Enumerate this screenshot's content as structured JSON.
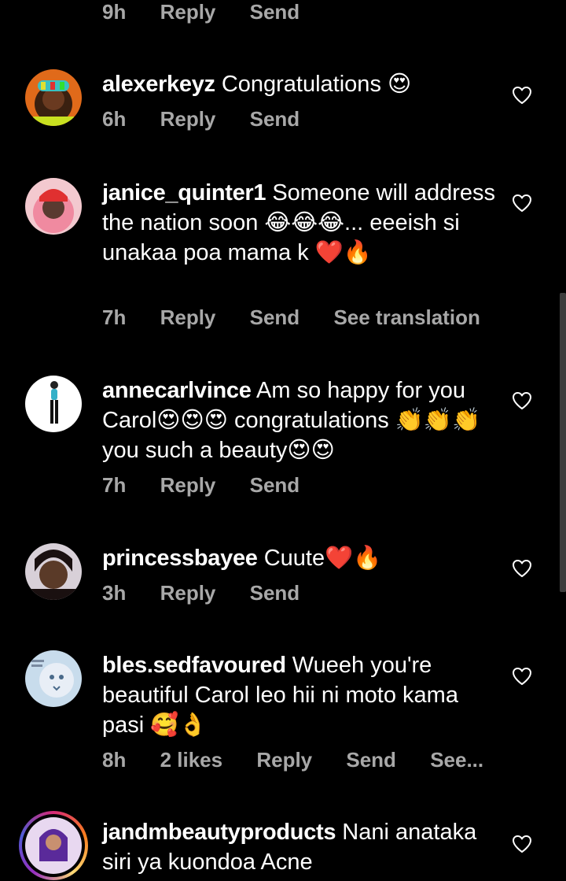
{
  "top_meta": {
    "time": "9h",
    "reply": "Reply",
    "send": "Send"
  },
  "comments": [
    {
      "username": "alexerkeyz",
      "text": "Congratulations 😍",
      "time": "6h",
      "reply": "Reply",
      "send": "Send"
    },
    {
      "username": "janice_quinter1",
      "text": "Someone will address the nation soon 😂😂😂... eeeish si unakaa poa mama k ❤️🔥",
      "time": "7h",
      "reply": "Reply",
      "send": "Send",
      "translation": "See translation"
    },
    {
      "username": "annecarlvince",
      "text": "Am so happy for you Carol😍😍😍 congratulations 👏👏👏you such a beauty😍😍",
      "time": "7h",
      "reply": "Reply",
      "send": "Send"
    },
    {
      "username": "princessbayee",
      "text": "Cuute❤️🔥",
      "time": "3h",
      "reply": "Reply",
      "send": "Send"
    },
    {
      "username": "bles.sedfavoured",
      "text": "Wueeh you're beautiful Carol leo hii ni moto kama pasi 🥰👌",
      "time": "8h",
      "likes": "2 likes",
      "reply": "Reply",
      "send": "Send",
      "see_more": "See..."
    },
    {
      "username": "jandmbeautyproducts",
      "text": "Nani anataka siri ya kuondoa Acne"
    }
  ],
  "colors": {
    "background": "#000000",
    "text": "#ffffff",
    "meta": "#a8a8a8"
  }
}
